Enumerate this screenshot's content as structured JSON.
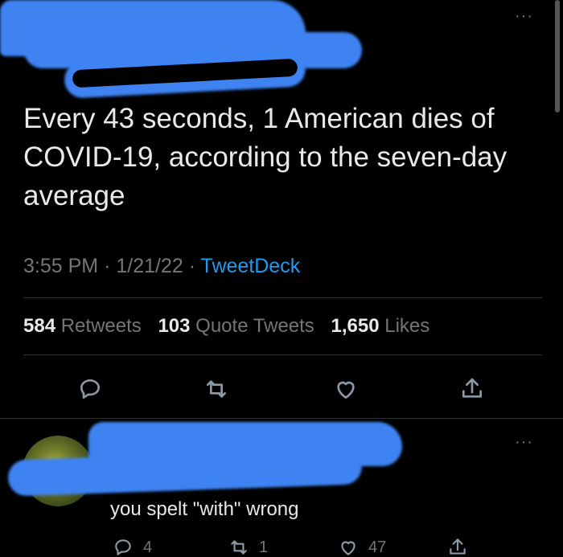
{
  "tweet": {
    "text": "Every 43 seconds, 1 American dies of COVID-19, according to the seven-day average",
    "time": "3:55 PM",
    "date": "1/21/22",
    "separator": "·",
    "client": "TweetDeck",
    "stats": {
      "retweets_count": "584",
      "retweets_label": "Retweets",
      "quotes_count": "103",
      "quotes_label": "Quote Tweets",
      "likes_count": "1,650",
      "likes_label": "Likes"
    },
    "more_label": "···"
  },
  "icons": {
    "reply": "reply-icon",
    "retweet": "retweet-icon",
    "like": "heart-icon",
    "share": "share-icon"
  },
  "reply": {
    "more_label": "···",
    "text": "you spelt \"with\" wrong",
    "reply_count": "4",
    "retweet_count": "1",
    "like_count": "47"
  },
  "colors": {
    "background": "#000000",
    "text": "#e7e9ea",
    "secondary": "#71767b",
    "accent": "#1d9bf0",
    "redaction": "#3f83f2",
    "divider": "#2f3336"
  }
}
